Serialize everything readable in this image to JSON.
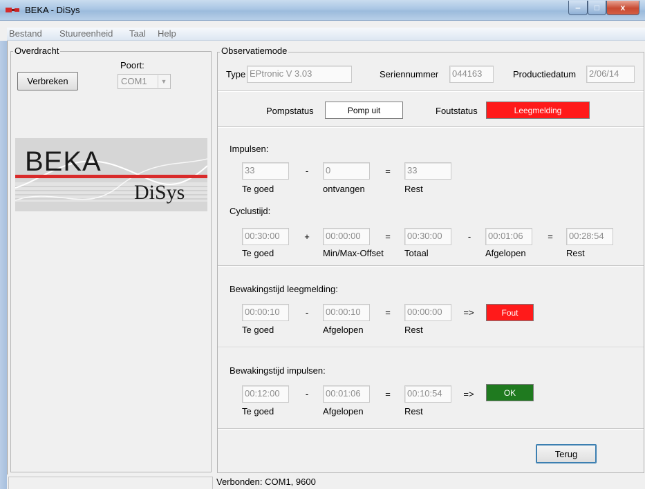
{
  "window": {
    "title": "BEKA - DiSys",
    "controls": {
      "minimize": "‒",
      "maximize": "□",
      "close": "x"
    }
  },
  "menu": [
    "Bestand",
    "Stuureenheid",
    "Taal",
    "Help"
  ],
  "left": {
    "group_title": "Overdracht",
    "disconnect_button": "Verbreken",
    "port_label": "Poort:",
    "port_value": "COM1",
    "logo": {
      "brand": "BEKA",
      "product": "DiSys",
      "red": "#d92b2b"
    }
  },
  "right": {
    "group_title": "Observatiemode",
    "type_label": "Type",
    "type_value": "EPtronic V 3.03",
    "serial_label": "Seriennummer",
    "serial_value": "044163",
    "date_label": "Productiedatum",
    "date_value": "2/06/14",
    "pump_status_label": "Pompstatus",
    "pump_status_value": "Pomp uit",
    "fault_status_label": "Foutstatus",
    "fault_status_value": "Leegmelding",
    "impulses": {
      "title": "Impulsen:",
      "good": "33",
      "received": "0",
      "rest": "33",
      "labels": [
        "Te goed",
        "ontvangen",
        "Rest"
      ],
      "ops": [
        "-",
        "="
      ]
    },
    "cycle": {
      "title": "Cyclustijd:",
      "good": "00:30:00",
      "offset": "00:00:00",
      "total": "00:30:00",
      "elapsed": "00:01:06",
      "rest": "00:28:54",
      "labels": [
        "Te goed",
        "Min/Max-Offset",
        "Totaal",
        "Afgelopen",
        "Rest"
      ],
      "ops": [
        "+",
        "=",
        "-",
        "="
      ]
    },
    "watch_empty": {
      "title": "Bewakingstijd leegmelding:",
      "good": "00:00:10",
      "elapsed": "00:00:10",
      "rest": "00:00:00",
      "result": "Fout",
      "labels": [
        "Te goed",
        "Afgelopen",
        "Rest"
      ],
      "ops": [
        "-",
        "=",
        "=>"
      ]
    },
    "watch_impulses": {
      "title": "Bewakingstijd impulsen:",
      "good": "00:12:00",
      "elapsed": "00:01:06",
      "rest": "00:10:54",
      "result": "OK",
      "labels": [
        "Te goed",
        "Afgelopen",
        "Rest"
      ],
      "ops": [
        "-",
        "=",
        "=>"
      ]
    },
    "back_button": "Terug"
  },
  "statusbar": {
    "text": "Verbonden: COM1,  9600"
  },
  "colors": {
    "error": "#ff1a1a",
    "ok": "#1f7a1f",
    "titlebar": "#b4cde7"
  }
}
